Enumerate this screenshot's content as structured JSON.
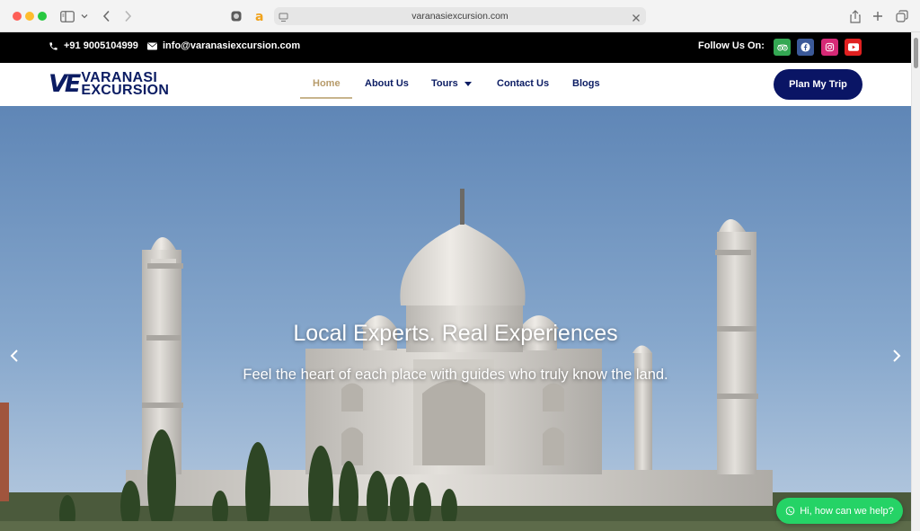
{
  "browser": {
    "url": "varanasiexcursion.com"
  },
  "topbar": {
    "phone": "+91 9005104999",
    "email": "info@varanasiexcursion.com",
    "follow_label": "Follow Us On:",
    "social_icons": [
      "tripadvisor-icon",
      "facebook-icon",
      "instagram-icon",
      "youtube-icon"
    ]
  },
  "logo": {
    "mark": "VE",
    "line1": "VARANASI",
    "line2": "EXCURSION"
  },
  "nav": {
    "items": [
      {
        "label": "Home",
        "active": true
      },
      {
        "label": "About Us"
      },
      {
        "label": "Tours",
        "has_dropdown": true
      },
      {
        "label": "Contact Us"
      },
      {
        "label": "Blogs"
      }
    ],
    "cta": "Plan My Trip"
  },
  "hero": {
    "title": "Local Experts. Real Experiences",
    "subtitle": "Feel the heart of each place with guides who truly know the land."
  },
  "chat": {
    "label": "Hi, how can we help?"
  },
  "colors": {
    "brand_navy": "#0b1c63",
    "nav_active": "#b79b6a",
    "topbar_bg": "#000000",
    "whatsapp_green": "#25d366"
  }
}
